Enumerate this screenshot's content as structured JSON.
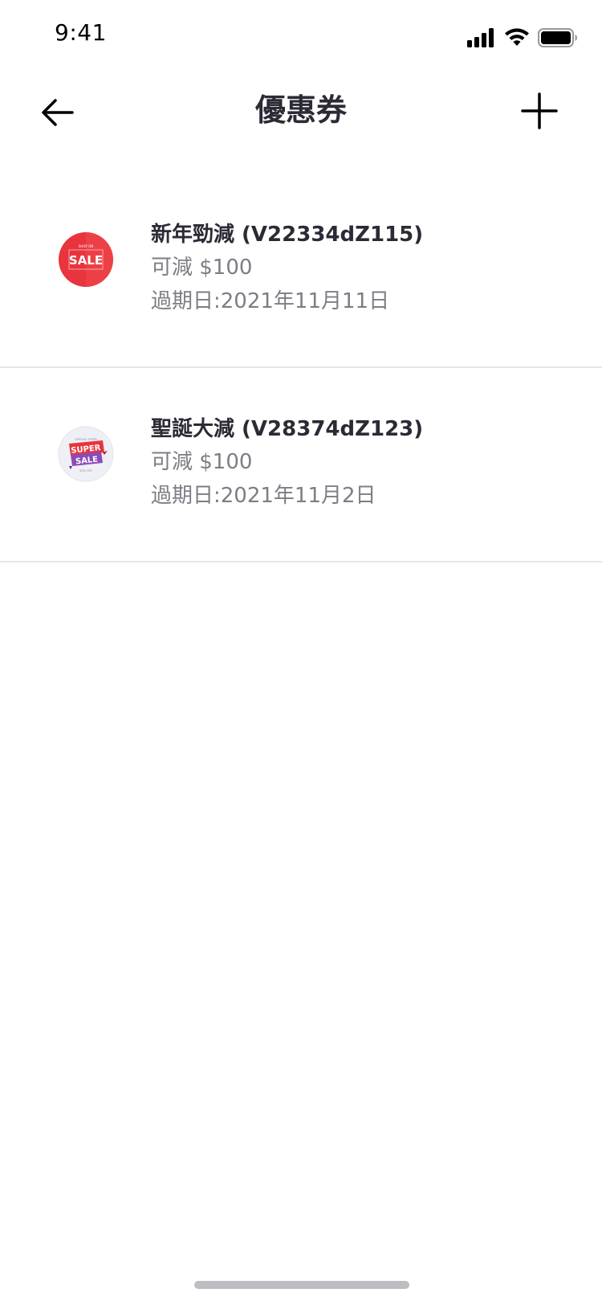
{
  "status_bar": {
    "time": "9:41"
  },
  "header": {
    "title": "優惠券"
  },
  "coupons": [
    {
      "icon": "sale-badge-icon",
      "title": "新年勁減 (V22334dZ115)",
      "amount": "可減 $100",
      "expiry": "過期日:2021年11月11日",
      "badge_text": "SALE",
      "badge_small_text": "SHOP ON"
    },
    {
      "icon": "super-sale-badge-icon",
      "title": "聖誕大減 (V28374dZ123)",
      "amount": "可減 $100",
      "expiry": "過期日:2021年11月2日",
      "badge_text_top": "SUPER",
      "badge_text_bottom": "SALE",
      "badge_small_top": "SPECIAL OFFER",
      "badge_small_bottom": "50% OFF"
    }
  ],
  "colors": {
    "title_text": "#2b2b36",
    "secondary_text": "#7d7d86",
    "divider": "#e6e6e9",
    "sale_red": "#e8343c",
    "super_sale_purple": "#8c4bb8"
  }
}
